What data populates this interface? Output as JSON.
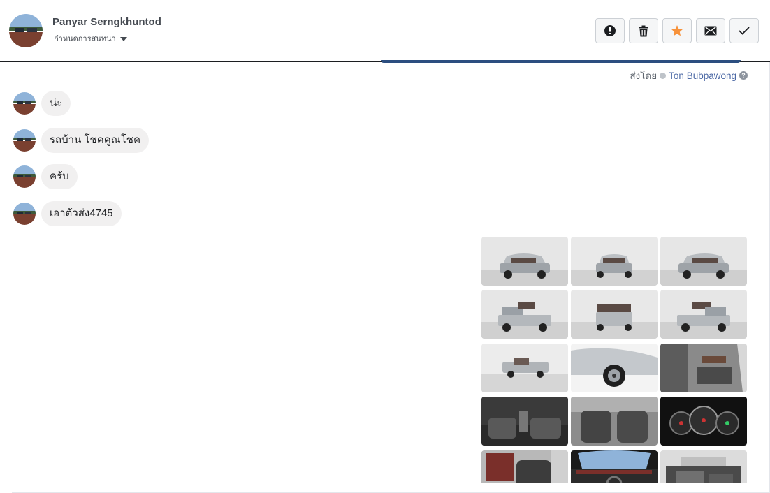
{
  "header": {
    "name": "Panyar Serngkhuntod",
    "subtitle": "กำหนดการสนทนา"
  },
  "toolbar": {
    "buttons": [
      {
        "icon": "alert-icon"
      },
      {
        "icon": "trash-icon"
      },
      {
        "icon": "star-icon",
        "color": "#f7923b"
      },
      {
        "icon": "envelope-icon"
      },
      {
        "icon": "check-icon"
      }
    ]
  },
  "sent_by": {
    "prefix": "ส่งโดย",
    "agent": "Ton Bubpawong"
  },
  "messages": [
    {
      "text": "น่ะ"
    },
    {
      "text": "รถบ้าน  โชคคูณโชค"
    },
    {
      "text": "ครับ"
    },
    {
      "text": "เอาตัวส่ง4745"
    }
  ],
  "gallery": {
    "image_count": 15,
    "thumbnails": [
      {
        "kind": "exterior-front-left"
      },
      {
        "kind": "exterior-front"
      },
      {
        "kind": "exterior-front-right"
      },
      {
        "kind": "exterior-rear-left"
      },
      {
        "kind": "exterior-rear"
      },
      {
        "kind": "exterior-rear-right"
      },
      {
        "kind": "exterior-side"
      },
      {
        "kind": "wheel-closeup"
      },
      {
        "kind": "door-interior"
      },
      {
        "kind": "interior-console"
      },
      {
        "kind": "interior-seats"
      },
      {
        "kind": "instrument-cluster"
      },
      {
        "kind": "interior-rear"
      },
      {
        "kind": "dashboard"
      },
      {
        "kind": "engine-bay"
      }
    ]
  },
  "colors": {
    "bubble": "#f1f0f0",
    "accent_star": "#f7923b",
    "agent_link": "#4b68a5"
  }
}
